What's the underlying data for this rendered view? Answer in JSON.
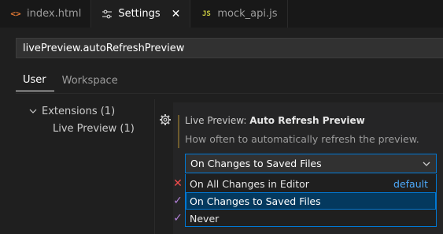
{
  "tabs": [
    {
      "label": "index.html",
      "icon": "html-file-icon",
      "glyph": "<>"
    },
    {
      "label": "Settings",
      "icon": "settings-sliders-icon",
      "close": "✕"
    },
    {
      "label": "mock_api.js",
      "icon": "javascript-file-icon",
      "glyph": "JS"
    }
  ],
  "search": {
    "value": "livePreview.autoRefreshPreview"
  },
  "scopes": [
    {
      "label": "User"
    },
    {
      "label": "Workspace"
    }
  ],
  "toc": {
    "items": [
      {
        "label": "Extensions (1)"
      },
      {
        "label": "Live Preview (1)"
      }
    ]
  },
  "setting": {
    "category": "Live Preview: ",
    "name": "Auto Refresh Preview",
    "description": "How often to automatically refresh the preview.",
    "value": "On Changes to Saved Files"
  },
  "dropdown": {
    "options": [
      {
        "label": "On All Changes in Editor",
        "tag": "default"
      },
      {
        "label": "On Changes to Saved Files"
      },
      {
        "label": "Never"
      }
    ]
  },
  "colors": {
    "accent": "#0078d4",
    "selection": "#04395e",
    "link": "#4daafc",
    "error": "#f14c4c",
    "check": "#b180d7"
  }
}
